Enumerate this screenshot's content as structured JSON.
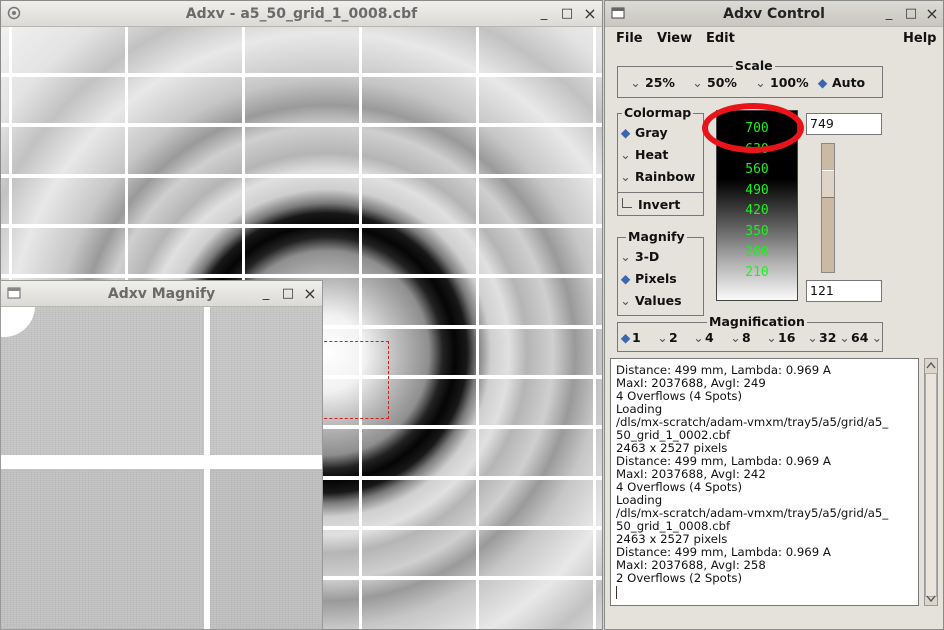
{
  "main_window": {
    "title": "Adxv - a5_50_grid_1_0008.cbf",
    "btn_min": "_",
    "btn_max": "□",
    "btn_close": "×"
  },
  "magnify_window": {
    "title": "Adxv Magnify",
    "btn_min": "_",
    "btn_max": "□",
    "btn_close": "×"
  },
  "control_window": {
    "title": "Adxv Control",
    "btn_min": "_",
    "btn_max": "□",
    "btn_close": "×",
    "menus": {
      "file": "File",
      "view": "View",
      "edit": "Edit",
      "help": "Help"
    },
    "scale": {
      "legend": "Scale",
      "options": [
        "25%",
        "50%",
        "100%",
        "Auto"
      ],
      "selected": "Auto"
    },
    "colormap": {
      "legend": "Colormap",
      "options": [
        "Gray",
        "Heat",
        "Rainbow"
      ],
      "selected": "Gray",
      "invert_label": "Invert",
      "invert_checked": false
    },
    "colorbar": {
      "labels": [
        "700",
        "630",
        "560",
        "490",
        "420",
        "350",
        "280",
        "210"
      ],
      "label_color": "#1ff01f",
      "max_value": "749",
      "min_value": "121",
      "slider_fraction": 0.26
    },
    "magnify": {
      "legend": "Magnify",
      "options": [
        "3-D",
        "Pixels",
        "Values"
      ],
      "selected": "Pixels"
    },
    "magnification": {
      "legend": "Magnification",
      "options": [
        "1",
        "2",
        "4",
        "8",
        "16",
        "32",
        "64"
      ],
      "selected": "1"
    },
    "log_lines": [
      "Distance: 499 mm, Lambda: 0.969 A",
      "MaxI: 2037688, AvgI: 249",
      "4 Overflows (4 Spots)",
      "Loading",
      "/dls/mx-scratch/adam-vmxm/tray5/a5/grid/a5_",
      "50_grid_1_0002.cbf",
      "2463 x 2527 pixels",
      "Distance: 499 mm, Lambda: 0.969 A",
      "MaxI: 2037688, AvgI: 242",
      "4 Overflows (4 Spots)",
      "Loading",
      "/dls/mx-scratch/adam-vmxm/tray5/a5/grid/a5_",
      "50_grid_1_0008.cbf",
      "2463 x 2527 pixels",
      "Distance: 499 mm, Lambda: 0.969 A",
      "MaxI: 2037688, AvgI: 258",
      "2 Overflows (2 Spots)"
    ],
    "annotation_color": "#e8141a"
  }
}
